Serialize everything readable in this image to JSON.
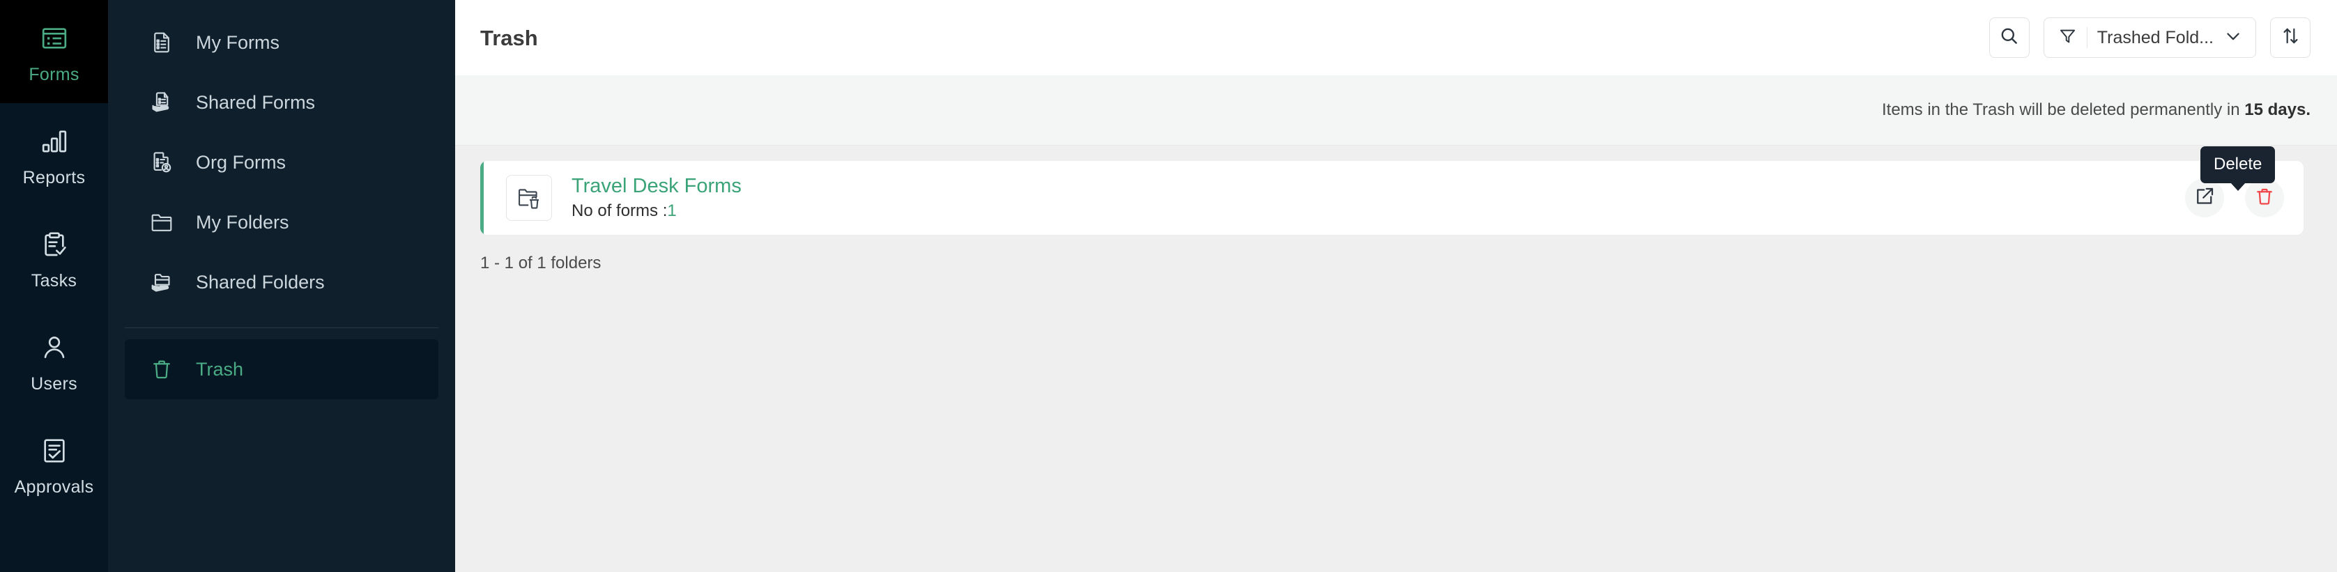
{
  "rail": {
    "items": [
      {
        "label": "Forms",
        "icon": "forms-icon",
        "active": true
      },
      {
        "label": "Reports",
        "icon": "reports-bar-chart-icon",
        "active": false
      },
      {
        "label": "Tasks",
        "icon": "tasks-clipboard-check-icon",
        "active": false
      },
      {
        "label": "Users",
        "icon": "users-person-icon",
        "active": false
      },
      {
        "label": "Approvals",
        "icon": "approvals-document-check-icon",
        "active": false
      }
    ]
  },
  "sidebar": {
    "items": [
      {
        "label": "My Forms",
        "icon": "document-list-icon",
        "active": false
      },
      {
        "label": "Shared Forms",
        "icon": "shared-document-hand-icon",
        "active": false
      },
      {
        "label": "Org Forms",
        "icon": "document-user-icon",
        "active": false
      },
      {
        "label": "My Folders",
        "icon": "folder-icon",
        "active": false
      },
      {
        "label": "Shared Folders",
        "icon": "shared-folder-hand-icon",
        "active": false
      }
    ],
    "trash": {
      "label": "Trash",
      "icon": "trash-icon",
      "active": true
    }
  },
  "header": {
    "title": "Trash",
    "search_icon": "search-icon",
    "filter": {
      "icon": "filter-funnel-icon",
      "label": "Trashed Fold...",
      "chevron": "chevron-down-icon"
    },
    "sort": {
      "icon": "sort-arrows-icon"
    }
  },
  "infobar": {
    "message_prefix": "Items in the Trash will be deleted permanently in ",
    "message_bold": "15 days."
  },
  "content": {
    "folder": {
      "icon": "folder-trash-icon",
      "name": "Travel Desk Forms",
      "forms_label": "No of forms :",
      "forms_count": "1",
      "restore_action": "restore-icon",
      "delete_action": "delete-trash-icon"
    },
    "tooltip": {
      "label": "Delete"
    },
    "pagination": "1 - 1 of 1 folders"
  },
  "colors": {
    "accent_green": "#3aa377",
    "rail_bg": "#061622",
    "sidebar_bg": "#101f2c",
    "danger_red": "#f0474a",
    "tooltip_bg": "#192430"
  }
}
